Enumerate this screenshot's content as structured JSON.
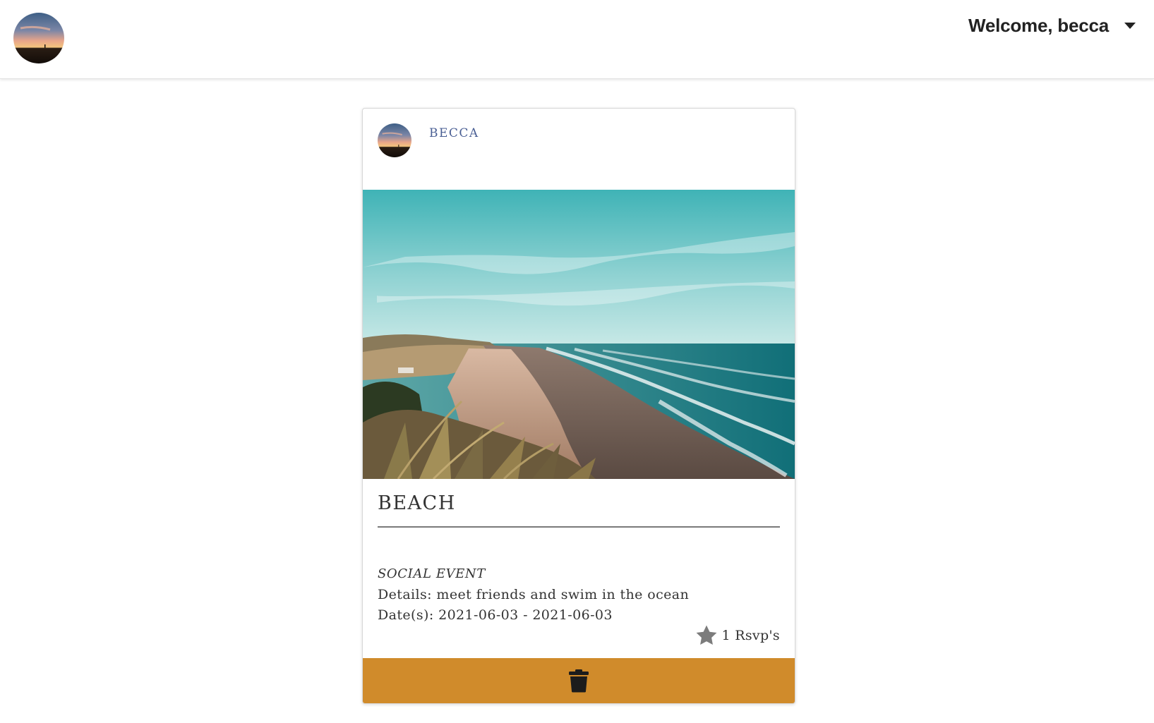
{
  "header": {
    "welcome_text": "Welcome, becca",
    "logo_icon": "profile-avatar-sunset",
    "menu_icon": "caret-down-icon"
  },
  "post": {
    "author": "BECCA",
    "author_icon": "profile-avatar-sunset",
    "image": "beach-coastline-photo",
    "title": "BEACH",
    "type": "SOCIAL EVENT",
    "details_label": "Details:",
    "details_value": "meet friends and swim in the ocean",
    "dates_label": "Date(s):",
    "dates_value": "2021-06-03 - 2021-06-03",
    "rsvp_icon": "star-icon",
    "rsvp_text": "1 Rsvp's",
    "delete_icon": "trash-icon"
  },
  "colors": {
    "accent": "#d08b2b",
    "author_link": "#4a5f94",
    "text": "#333333",
    "star": "#7c7c7c"
  }
}
